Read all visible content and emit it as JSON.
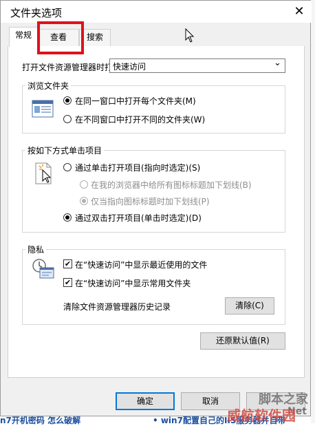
{
  "window": {
    "title": "文件夹选项",
    "close_glyph": "✕"
  },
  "tabs": [
    {
      "label": "常规"
    },
    {
      "label": "查看"
    },
    {
      "label": "搜索"
    }
  ],
  "open_explorer": {
    "label": "打开文件资源管理器时打",
    "value": "快速访问",
    "arrow": "⌄"
  },
  "browse": {
    "title": "浏览文件夹",
    "options": [
      {
        "label": "在同一窗口中打开每个文件夹(M)",
        "selected": true
      },
      {
        "label": "在不同窗口中打开不同的文件夹(W)",
        "selected": false
      }
    ]
  },
  "click": {
    "title": "按如下方式单击项目",
    "single": {
      "label": "通过单击打开项目(指向时选定)(S)",
      "selected": false
    },
    "underline_all": {
      "label": "在我的浏览器中给所有图标标题加下划线(B)",
      "selected": false
    },
    "underline_hover": {
      "label": "仅当指向图标标题时加下划线(P)",
      "selected": true
    },
    "double": {
      "label": "通过双击打开项目(单击时选定)(D)",
      "selected": true
    }
  },
  "privacy": {
    "title": "隐私",
    "recent_files": {
      "label": "在“快速访问”中显示最近使用的文件",
      "checked": true
    },
    "frequent_folders": {
      "label": "在“快速访问”中显示常用文件夹",
      "checked": true
    },
    "clear_text": "清除文件资源管理器历史记录",
    "clear_button": "清除(C)"
  },
  "restore_button": "还原默认值(R)",
  "footer": {
    "ok": "确定",
    "cancel": "取消"
  },
  "background_text": {
    "bottom_left": "n7开机密码 怎么破解",
    "bottom_mid": "• win7配置自己的IIS服务器并自带"
  },
  "watermarks": {
    "main": "威航软件园",
    "secondary": "脚本之家",
    "net": "Net"
  },
  "colors": {
    "highlight": "#e0101c",
    "focus": "#0078d7",
    "panel": "#ffffff",
    "dialog": "#f0f0f0"
  }
}
